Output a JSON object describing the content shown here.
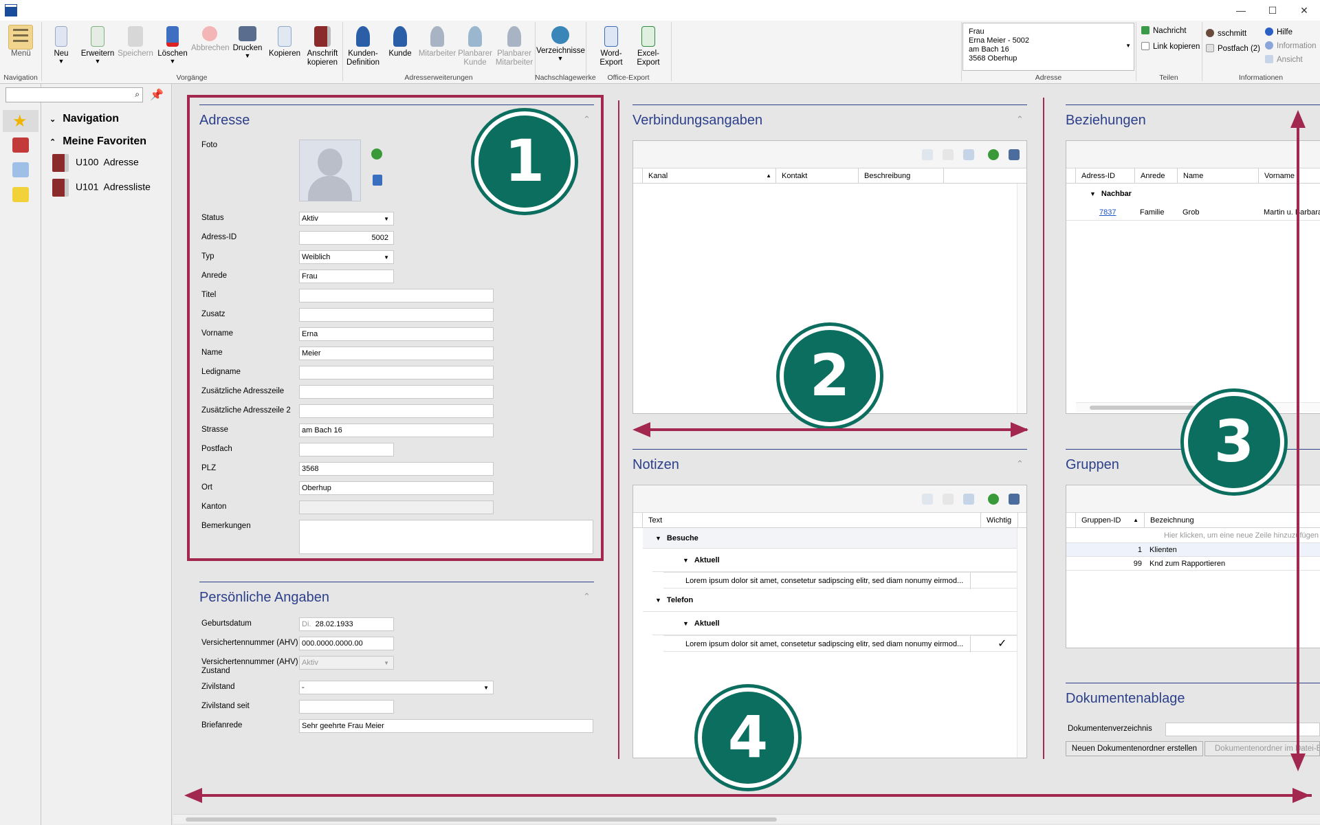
{
  "window": {
    "min": "—",
    "max": "☐",
    "close": "✕"
  },
  "ribbon": {
    "menu": "Menü",
    "groups": {
      "navigation": "Navigation",
      "vorgaenge": "Vorgänge",
      "adresserweiterungen": "Adresserweiterungen",
      "nachschlagewerke": "Nachschlagewerke",
      "office": "Office-Export",
      "adresse": "Adresse",
      "teilen": "Teilen",
      "informationen": "Informationen"
    },
    "buttons": {
      "neu": "Neu",
      "erweitern": "Erweitern",
      "speichern": "Speichern",
      "loeschen": "Löschen",
      "abbrechen": "Abbrechen",
      "drucken": "Drucken",
      "kopieren": "Kopieren",
      "anschrift1": "Anschrift",
      "anschrift2": "kopieren",
      "kundendef1": "Kunden-",
      "kundendef2": "Definition",
      "kunde": "Kunde",
      "mitarbeiter": "Mitarbeiter",
      "planbarer_kunde1": "Planbarer",
      "planbarer_kunde2": "Kunde",
      "planbarer_ma1": "Planbarer",
      "planbarer_ma2": "Mitarbeiter",
      "verzeichnisse": "Verzeichnisse",
      "word1": "Word-",
      "word2": "Export",
      "excel1": "Excel-",
      "excel2": "Export"
    },
    "address": {
      "l1": "Frau",
      "l2": "Erna Meier - 5002",
      "l3": "am Bach 16",
      "l4": "3568 Oberhup"
    },
    "teilen": {
      "nachricht": "Nachricht",
      "link": "Link kopieren"
    },
    "info": {
      "user": "sschmitt",
      "postfach": "Postfach (2)",
      "hilfe": "Hilfe",
      "information": "Information",
      "ansicht": "Ansicht"
    }
  },
  "nav": {
    "navigation": "Navigation",
    "favoriten": "Meine Favoriten",
    "items": [
      {
        "code": "U100",
        "label": "Adresse"
      },
      {
        "code": "U101",
        "label": "Adressliste"
      }
    ]
  },
  "adresse": {
    "title": "Adresse",
    "foto": "Foto",
    "fields": {
      "status": {
        "label": "Status",
        "value": "Aktiv"
      },
      "adressid": {
        "label": "Adress-ID",
        "value": "5002"
      },
      "typ": {
        "label": "Typ",
        "value": "Weiblich"
      },
      "anrede": {
        "label": "Anrede",
        "value": "Frau"
      },
      "titel": {
        "label": "Titel",
        "value": ""
      },
      "zusatz": {
        "label": "Zusatz",
        "value": ""
      },
      "vorname": {
        "label": "Vorname",
        "value": "Erna"
      },
      "name": {
        "label": "Name",
        "value": "Meier"
      },
      "ledigname": {
        "label": "Ledigname",
        "value": ""
      },
      "zusatz1": {
        "label": "Zusätzliche Adresszeile",
        "value": ""
      },
      "zusatz2": {
        "label": "Zusätzliche Adresszeile 2",
        "value": ""
      },
      "strasse": {
        "label": "Strasse",
        "value": "am Bach 16"
      },
      "postfach": {
        "label": "Postfach",
        "value": ""
      },
      "plz": {
        "label": "PLZ",
        "value": "3568"
      },
      "ort": {
        "label": "Ort",
        "value": "Oberhup"
      },
      "kanton": {
        "label": "Kanton",
        "value": ""
      },
      "bemerkungen": {
        "label": "Bemerkungen",
        "value": ""
      }
    }
  },
  "persoenlich": {
    "title": "Persönliche Angaben",
    "geburtsdatum": {
      "label": "Geburtsdatum",
      "day": "Di.",
      "value": "28.02.1933"
    },
    "ahv": {
      "label": "Versichertennummer (AHV)",
      "value": "000.0000.0000.00"
    },
    "ahvz": {
      "label1": "Versichertennummer (AHV)",
      "label2": "Zustand",
      "value": "Aktiv"
    },
    "zivilstand": {
      "label": "Zivilstand",
      "value": "-"
    },
    "zivilseit": {
      "label": "Zivilstand seit",
      "value": ""
    },
    "briefanrede": {
      "label": "Briefanrede",
      "value": "Sehr geehrte Frau Meier"
    }
  },
  "verbindung": {
    "title": "Verbindungsangaben",
    "cols": [
      "Kanal",
      "Kontakt",
      "Beschreibung"
    ]
  },
  "notizen": {
    "title": "Notizen",
    "cols": [
      "Text",
      "Wichtig"
    ],
    "groups": [
      {
        "name": "Besuche",
        "sub": "Aktuell",
        "text": "Lorem ipsum dolor sit amet, consetetur sadipscing elitr, sed diam nonumy eirmod...",
        "wichtig": ""
      },
      {
        "name": "Telefon",
        "sub": "Aktuell",
        "text": "Lorem ipsum dolor sit amet, consetetur sadipscing elitr, sed diam nonumy eirmod...",
        "wichtig": "✓"
      }
    ]
  },
  "beziehungen": {
    "title": "Beziehungen",
    "cols": [
      "Adress-ID",
      "Anrede",
      "Name",
      "Vorname"
    ],
    "group": "Nachbar",
    "row": {
      "id": "7837",
      "anrede": "Familie",
      "name": "Grob",
      "vorname": "Martin u. Barbara"
    }
  },
  "gruppen": {
    "title": "Gruppen",
    "cols": [
      "Gruppen-ID",
      "Bezeichnung"
    ],
    "newrow": "Hier klicken, um eine neue Zeile hinzuzufügen",
    "rows": [
      {
        "id": "1",
        "name": "Klienten"
      },
      {
        "id": "99",
        "name": "Knd zum Rapportieren"
      }
    ]
  },
  "dokumente": {
    "title": "Dokumentenablage",
    "verzeichnis": "Dokumentenverzeichnis",
    "btn1": "Neuen Dokumentenordner erstellen",
    "btn2": "Dokumentenordner im Datei-Explorer öffnen"
  },
  "callouts": [
    "1",
    "2",
    "3",
    "4"
  ]
}
